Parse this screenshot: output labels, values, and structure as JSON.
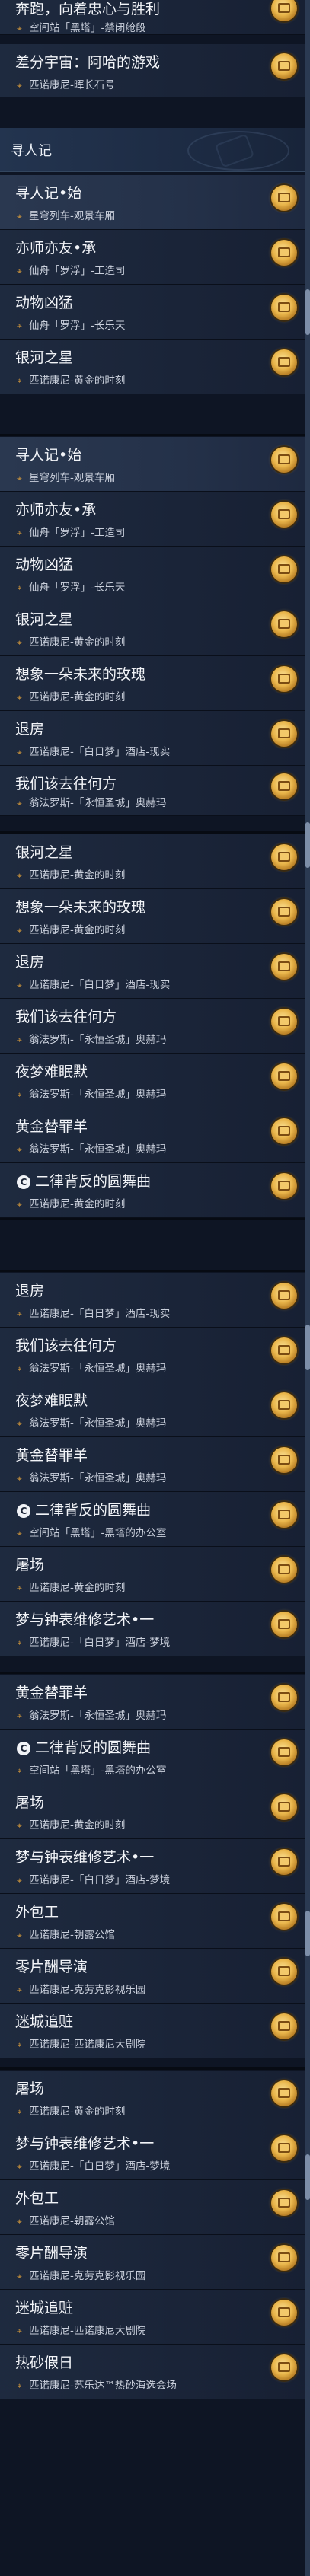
{
  "section_header": {
    "title": "寻人记"
  },
  "rows": [
    {
      "title": "奔跑，向着忠心与胜利",
      "sub": "空间站「黑塔」-禁闭舱段",
      "icon": ""
    },
    {
      "title": "差分宇宙：阿哈的游戏",
      "sub": "匹诺康尼-晖长石号",
      "icon": ""
    },
    {
      "title": "寻人记•始",
      "sub": "星穹列车-观景车厢",
      "icon": ""
    },
    {
      "title": "亦师亦友•承",
      "sub": "仙舟「罗浮」-工造司",
      "icon": ""
    },
    {
      "title": "动物凶猛",
      "sub": "仙舟「罗浮」-长乐天",
      "icon": ""
    },
    {
      "title": "银河之星",
      "sub": "匹诺康尼-黄金的时刻",
      "icon": ""
    },
    {
      "title": "寻人记•始",
      "sub": "星穹列车-观景车厢",
      "icon": ""
    },
    {
      "title": "亦师亦友•承",
      "sub": "仙舟「罗浮」-工造司",
      "icon": ""
    },
    {
      "title": "动物凶猛",
      "sub": "仙舟「罗浮」-长乐天",
      "icon": ""
    },
    {
      "title": "银河之星",
      "sub": "匹诺康尼-黄金的时刻",
      "icon": ""
    },
    {
      "title": "想象一朵未来的玫瑰",
      "sub": "匹诺康尼-黄金的时刻",
      "icon": ""
    },
    {
      "title": "退房",
      "sub": "匹诺康尼-「白日梦」酒店-现实",
      "icon": ""
    },
    {
      "title": "我们该去往何方",
      "sub": "翁法罗斯-「永恒圣城」奥赫玛",
      "icon": ""
    },
    {
      "title": "银河之星",
      "sub": "匹诺康尼-黄金的时刻",
      "icon": ""
    },
    {
      "title": "想象一朵未来的玫瑰",
      "sub": "匹诺康尼-黄金的时刻",
      "icon": ""
    },
    {
      "title": "退房",
      "sub": "匹诺康尼-「白日梦」酒店-现实",
      "icon": ""
    },
    {
      "title": "我们该去往何方",
      "sub": "翁法罗斯-「永恒圣城」奥赫玛",
      "icon": ""
    },
    {
      "title": "夜梦难眠默",
      "sub": "翁法罗斯-「永恒圣城」奥赫玛",
      "icon": ""
    },
    {
      "title": "黄金替罪羊",
      "sub": "翁法罗斯-「永恒圣城」奥赫玛",
      "icon": ""
    },
    {
      "title": "二律背反的圆舞曲",
      "sub": "匹诺康尼-黄金的时刻",
      "icon": "C"
    },
    {
      "title": "退房",
      "sub": "匹诺康尼-「白日梦」酒店-现实",
      "icon": ""
    },
    {
      "title": "我们该去往何方",
      "sub": "翁法罗斯-「永恒圣城」奥赫玛",
      "icon": ""
    },
    {
      "title": "夜梦难眠默",
      "sub": "翁法罗斯-「永恒圣城」奥赫玛",
      "icon": ""
    },
    {
      "title": "黄金替罪羊",
      "sub": "翁法罗斯-「永恒圣城」奥赫玛",
      "icon": ""
    },
    {
      "title": "二律背反的圆舞曲",
      "sub": "空间站「黑塔」-黑塔的办公室",
      "icon": "C"
    },
    {
      "title": "屠场",
      "sub": "匹诺康尼-黄金的时刻",
      "icon": ""
    },
    {
      "title": "梦与钟表维修艺术•一",
      "sub": "匹诺康尼-「白日梦」酒店-梦境",
      "icon": ""
    },
    {
      "title": "黄金替罪羊",
      "sub": "翁法罗斯-「永恒圣城」奥赫玛",
      "icon": ""
    },
    {
      "title": "二律背反的圆舞曲",
      "sub": "空间站「黑塔」-黑塔的办公室",
      "icon": "C"
    },
    {
      "title": "屠场",
      "sub": "匹诺康尼-黄金的时刻",
      "icon": ""
    },
    {
      "title": "梦与钟表维修艺术•一",
      "sub": "匹诺康尼-「白日梦」酒店-梦境",
      "icon": ""
    },
    {
      "title": "外包工",
      "sub": "匹诺康尼-朝露公馆",
      "icon": ""
    },
    {
      "title": "零片酬导演",
      "sub": "匹诺康尼-克劳克影视乐园",
      "icon": ""
    },
    {
      "title": "迷城追赃",
      "sub": "匹诺康尼-匹诺康尼大剧院",
      "icon": ""
    },
    {
      "title": "屠场",
      "sub": "匹诺康尼-黄金的时刻",
      "icon": ""
    },
    {
      "title": "梦与钟表维修艺术•一",
      "sub": "匹诺康尼-「白日梦」酒店-梦境",
      "icon": ""
    },
    {
      "title": "外包工",
      "sub": "匹诺康尼-朝露公馆",
      "icon": ""
    },
    {
      "title": "零片酬导演",
      "sub": "匹诺康尼-克劳克影视乐园",
      "icon": ""
    },
    {
      "title": "迷城追赃",
      "sub": "匹诺康尼-匹诺康尼大剧院",
      "icon": ""
    },
    {
      "title": "热砂假日",
      "sub": "匹诺康尼-苏乐达™热砂海选会场",
      "icon": ""
    }
  ]
}
